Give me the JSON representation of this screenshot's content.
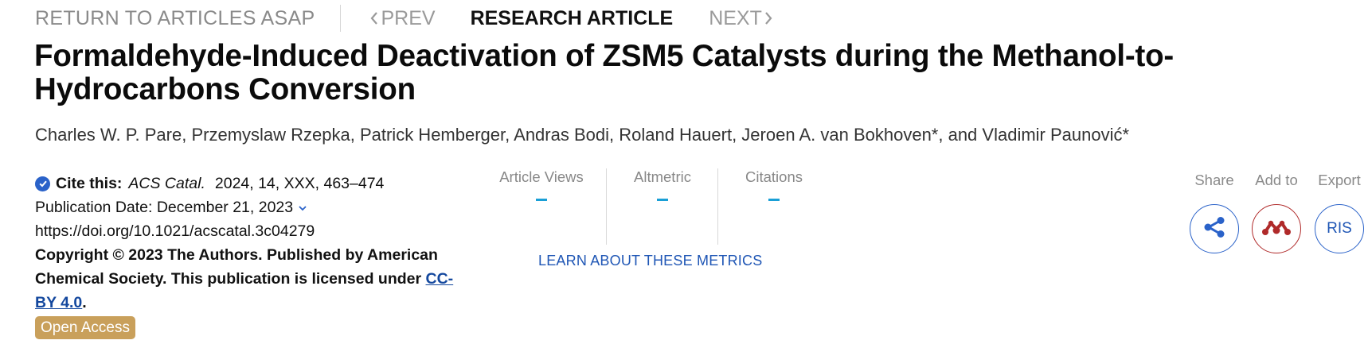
{
  "nav": {
    "return_label": "RETURN TO ARTICLES ASAP",
    "prev_label": "PREV",
    "current_label": "RESEARCH ARTICLE",
    "next_label": "NEXT"
  },
  "article": {
    "title": "Formaldehyde-Induced Deactivation of ZSM5 Catalysts during the Methanol-to-Hydrocarbons Conversion",
    "authors": "Charles W. P. Pare, Przemyslaw Rzepka, Patrick Hemberger, Andras Bodi, Roland Hauert, Jeroen A. van Bokhoven*, and Vladimir Paunović*"
  },
  "citation": {
    "label": "Cite this:",
    "journal": "ACS Catal.",
    "details": "2024, 14, XXX, 463–474",
    "pub_date": "Publication Date: December 21, 2023",
    "doi": "https://doi.org/10.1021/acscatal.3c04279",
    "copyright": "Copyright © 2023 The Authors. Published by American Chemical Society. This publication is licensed under",
    "license": "CC-BY 4.0",
    "license_suffix": ".",
    "access": "Open Access"
  },
  "metrics": {
    "items": [
      {
        "label": "Article Views"
      },
      {
        "label": "Altmetric"
      },
      {
        "label": "Citations"
      }
    ],
    "learn_label": "LEARN ABOUT THESE METRICS"
  },
  "actions": {
    "share_label": "Share",
    "add_label": "Add to",
    "export_label": "Export",
    "ris_label": "RIS"
  },
  "icons": {
    "check": "check-circle-icon",
    "chevron_left": "chevron-left-icon",
    "chevron_right": "chevron-right-icon",
    "chevron_down": "chevron-down-icon",
    "share": "share-icon",
    "mendeley": "mendeley-icon"
  },
  "colors": {
    "accent_blue": "#2a62c9",
    "link_blue": "#1f56b5",
    "metric_dash": "#1a9fd6",
    "open_access": "#c9a05b",
    "mendeley_red": "#b02a2a"
  }
}
